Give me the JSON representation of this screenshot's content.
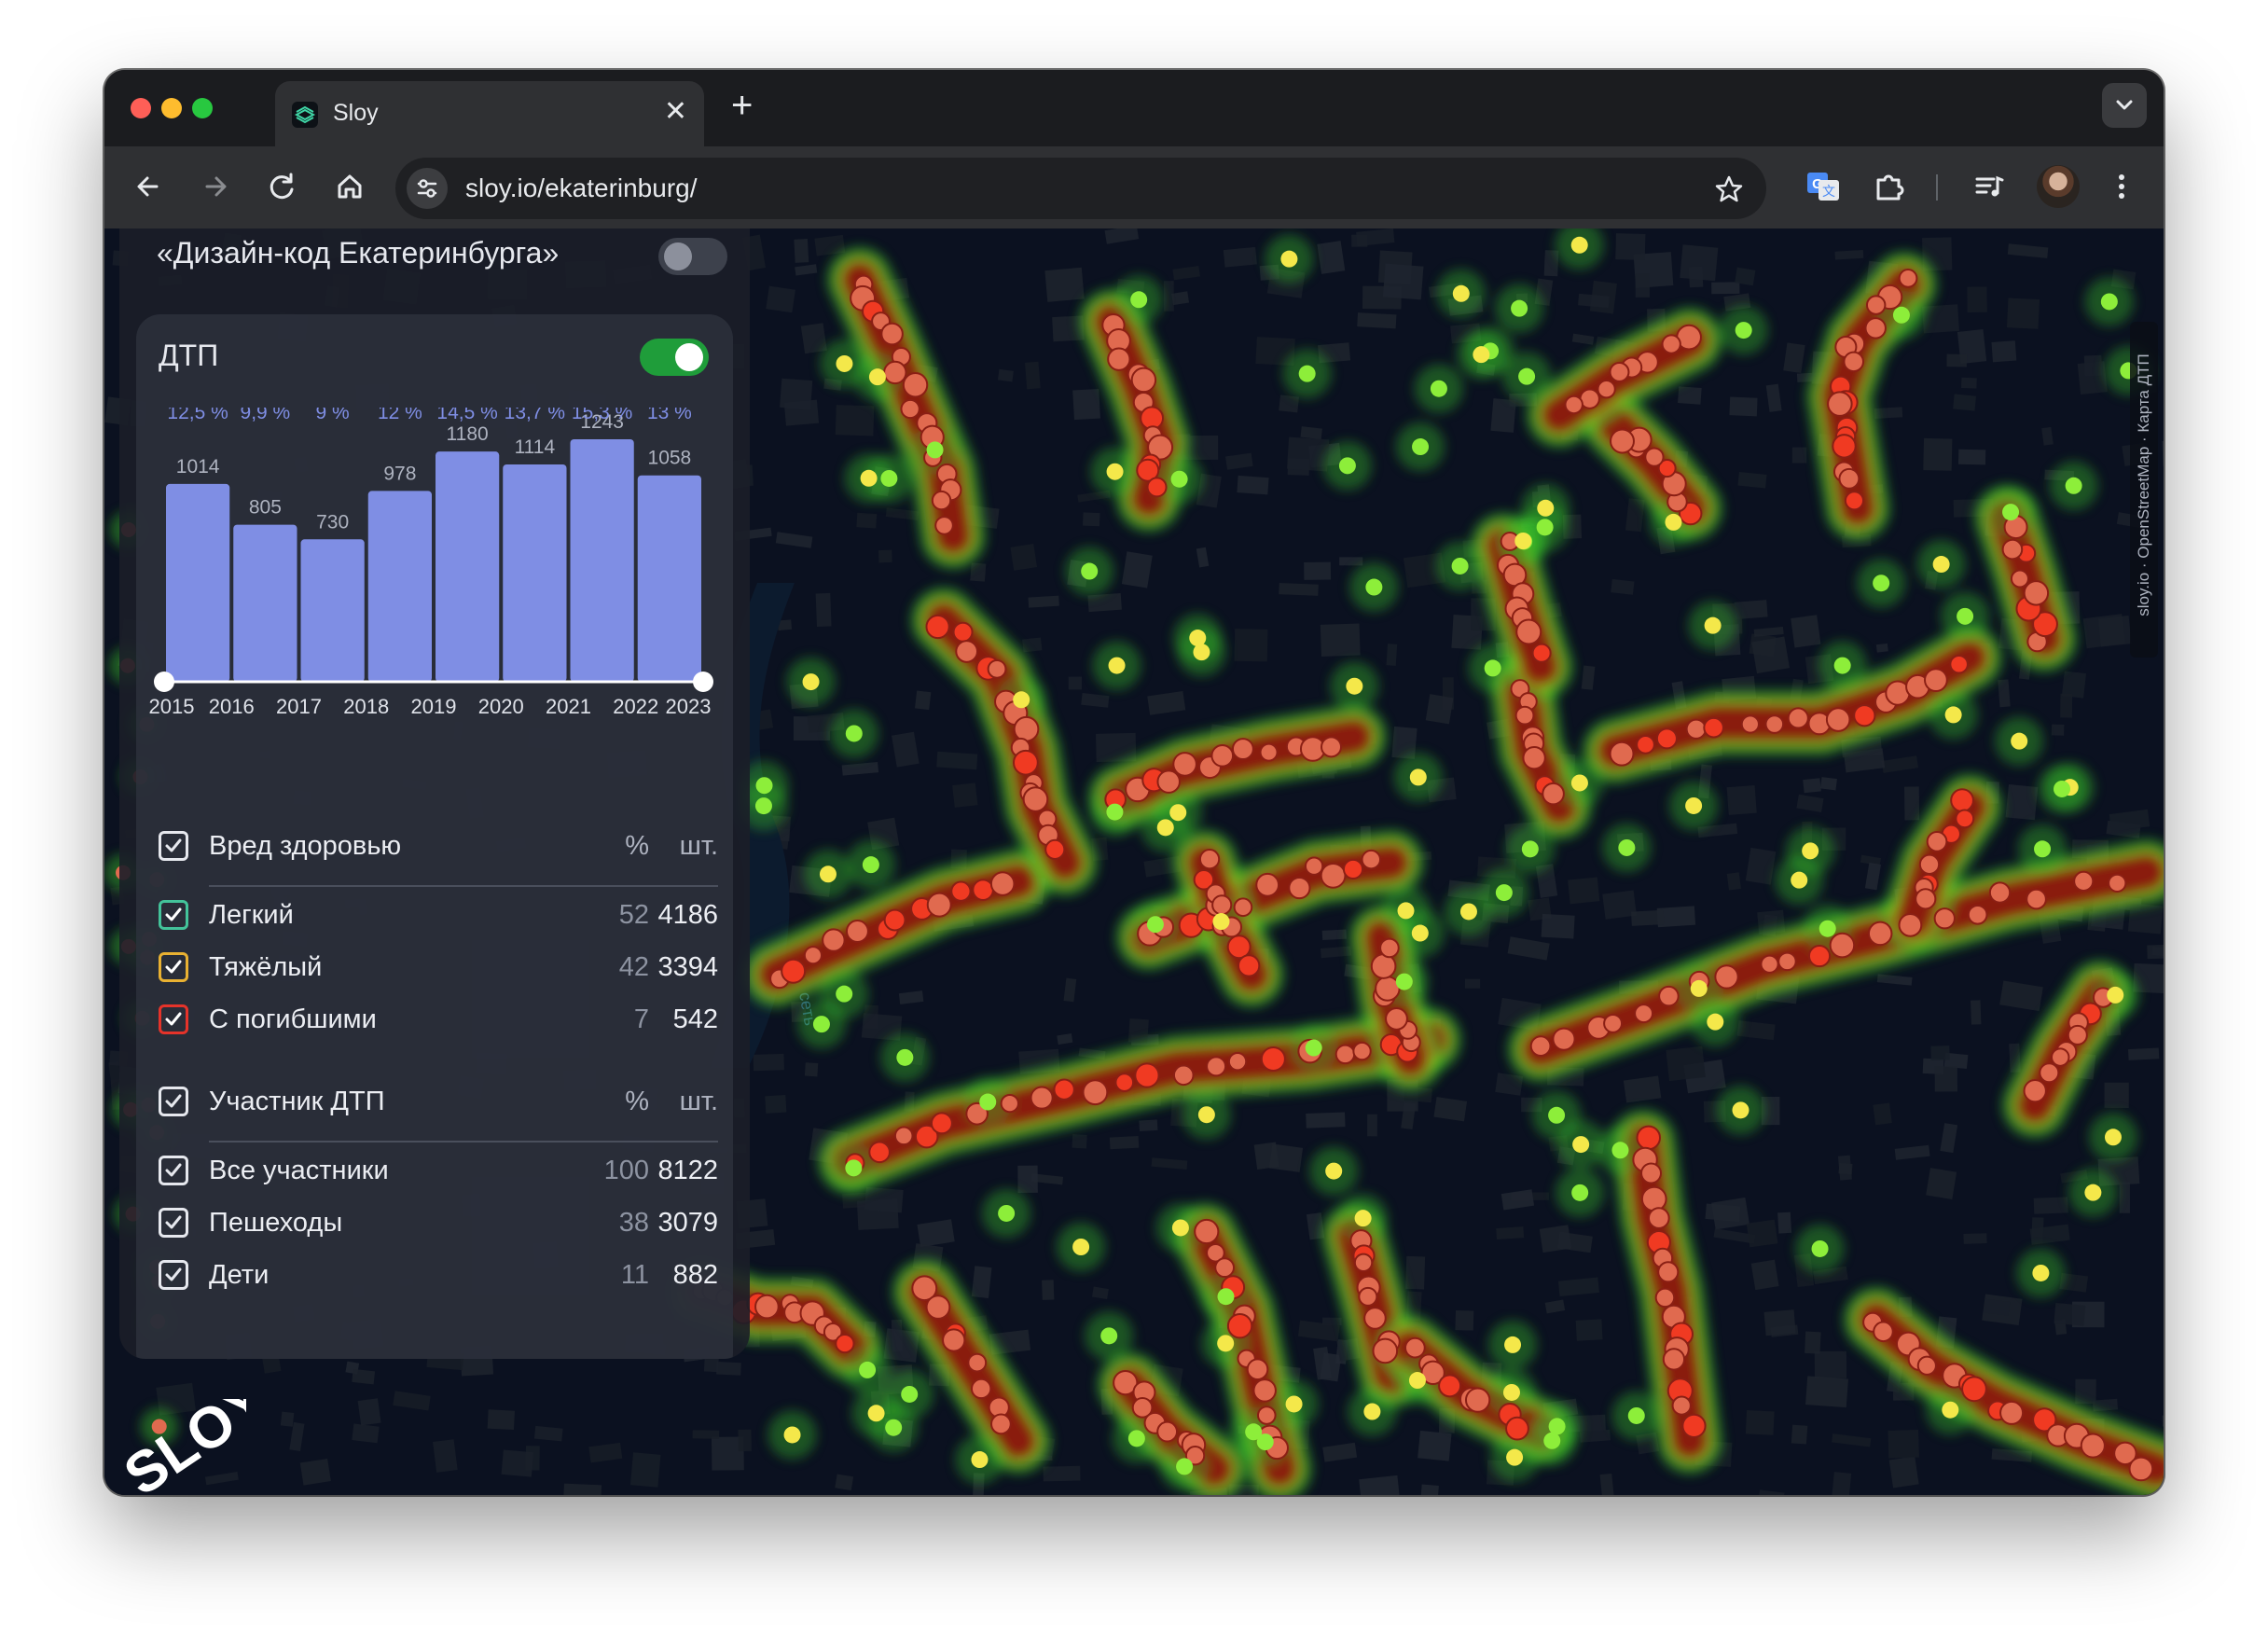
{
  "browser": {
    "tab_title": "Sloy",
    "tab_close": "✕",
    "new_tab": "+",
    "url": "sloy.io/ekaterinburg/",
    "traffic_lights": [
      "#fe5f57",
      "#febc2e",
      "#28c840"
    ],
    "icons": [
      "back-icon",
      "forward-icon",
      "reload-icon",
      "home-icon",
      "site-info-icon",
      "star-icon",
      "translate-icon",
      "extensions-icon",
      "media-icon",
      "profile-avatar",
      "menu-icon",
      "tab-list-icon"
    ]
  },
  "panel": {
    "layer_name": "«Дизайн-код Екатеринбурга»",
    "layer_enabled": false,
    "dtp": {
      "title": "ДТП",
      "enabled": true,
      "accent": "#1f9d3a"
    },
    "harm": {
      "header": {
        "label": "Вред здоровью",
        "pct": "%",
        "cnt": "шт."
      },
      "rows": [
        {
          "label": "Легкий",
          "pct": "52",
          "cnt": "4186",
          "color": "#43c39a"
        },
        {
          "label": "Тяжёлый",
          "pct": "42",
          "cnt": "3394",
          "color": "#e9b132"
        },
        {
          "label": "С погибшими",
          "pct": "7",
          "cnt": "542",
          "color": "#e5332a"
        }
      ]
    },
    "participants": {
      "header": {
        "label": "Участник ДТП",
        "pct": "%",
        "cnt": "шт."
      },
      "rows": [
        {
          "label": "Все участники",
          "pct": "100",
          "cnt": "8122"
        },
        {
          "label": "Пешеходы",
          "pct": "38",
          "cnt": "3079"
        },
        {
          "label": "Дети",
          "pct": "11",
          "cnt": "882"
        }
      ]
    }
  },
  "map": {
    "attribution": "sloy.io · OpenStreetMap · Карта ДТП",
    "logo": "SLOY",
    "street_label": "сеть"
  },
  "chart_data": {
    "type": "bar",
    "categories": [
      "2015",
      "2016",
      "2017",
      "2018",
      "2019",
      "2020",
      "2021",
      "2022",
      "2023"
    ],
    "values": [
      1014,
      805,
      730,
      978,
      1180,
      1114,
      1243,
      1058
    ],
    "bar_labels": [
      "2015",
      "2016",
      "2017",
      "2018",
      "2019",
      "2020",
      "2021",
      "2022"
    ],
    "change_labels": [
      "12,5 %",
      "9,9 %",
      "9 %",
      "12 %",
      "14,5 %",
      "13,7 %",
      "15,3 %",
      "13 %"
    ],
    "ylim": [
      0,
      1243
    ],
    "range_selected": [
      "2015",
      "2023"
    ],
    "bar_color": "#7f8ee4",
    "grid": false,
    "title": "",
    "xlabel": "",
    "ylabel": ""
  }
}
